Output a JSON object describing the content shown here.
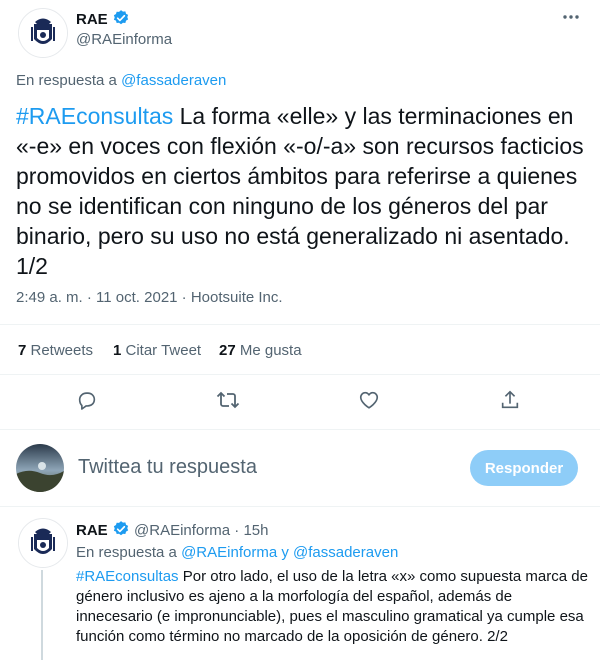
{
  "tweet": {
    "author_name": "RAE",
    "author_handle": "@RAEinforma",
    "reply_prefix": "En respuesta a ",
    "reply_to": "@fassaderaven",
    "hashtag": "#RAEconsultas",
    "text": " La forma «elle» y las terminaciones en «-e» en voces con flexión «-o/-a» son recursos facticios promovidos en ciertos ámbitos para referirse a quienes no se identifican con ninguno de los géneros del par binario, pero su uso no está generalizado ni asentado. 1/2",
    "time": "2:49 a. m.",
    "sep": " · ",
    "date": "11 oct. 2021",
    "source": "Hootsuite Inc.",
    "more_icon": "more-dots-icon"
  },
  "stats": {
    "retweets_count": "7",
    "retweets_label": " Retweets",
    "quotes_count": "1",
    "quotes_label": " Citar Tweet",
    "likes_count": "27",
    "likes_label": " Me gusta"
  },
  "actions": {
    "icons": [
      "reply-icon",
      "retweet-icon",
      "like-icon",
      "share-icon"
    ]
  },
  "composer": {
    "placeholder": "Twittea tu respuesta",
    "button_label": "Responder"
  },
  "reply": {
    "author_name": "RAE",
    "author_handle": "@RAEinforma",
    "sep": " · ",
    "age": "15h",
    "reply_prefix": "En respuesta a ",
    "reply_to_1": "@RAEinforma",
    "reply_and": " y ",
    "reply_to_2": "@fassaderaven",
    "hashtag": "#RAEconsultas",
    "text": " Por otro lado, el uso de la letra «x» como supuesta marca de género inclusivo es ajeno a la morfología del español, además de innecesario (e impronunciable), pues el masculino gramatical ya cumple esa función como término no marcado de la oposición de género. 2/2"
  },
  "colors": {
    "accent": "#1d9bf0",
    "button_disabled": "#8ecdf8",
    "muted_text": "#536471"
  }
}
